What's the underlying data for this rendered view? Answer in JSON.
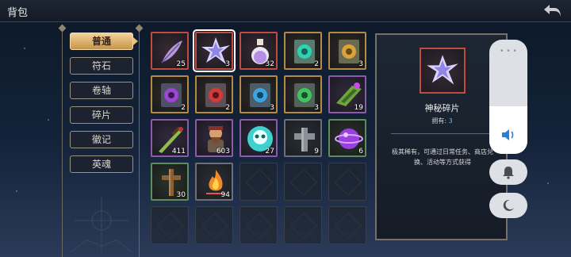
{
  "title": "背包",
  "icons": {
    "back": "back-arrow-icon",
    "volume": "speaker-icon",
    "bell": "bell-icon",
    "moon": "moon-icon"
  },
  "tabs": [
    {
      "label": "普通",
      "active": true
    },
    {
      "label": "符石",
      "active": false
    },
    {
      "label": "卷轴",
      "active": false
    },
    {
      "label": "碎片",
      "active": false
    },
    {
      "label": "徽记",
      "active": false
    },
    {
      "label": "英魂",
      "active": false
    }
  ],
  "inventory": {
    "rows": [
      [
        {
          "icon": "feather-quill-icon",
          "rarity": "red",
          "count": "25"
        },
        {
          "icon": "crystal-shard-icon",
          "rarity": "red",
          "count": "3",
          "selected": true
        },
        {
          "icon": "potion-flask-icon",
          "rarity": "red",
          "count": "32"
        },
        {
          "icon": "teal-rune-scroll-icon",
          "rarity": "gold",
          "count": "2"
        },
        {
          "icon": "gold-rune-scroll-icon",
          "rarity": "gold",
          "count": "3"
        }
      ],
      [
        {
          "icon": "purple-rune-scroll-icon",
          "rarity": "gold",
          "count": "2"
        },
        {
          "icon": "red-rune-scroll-icon",
          "rarity": "gold",
          "count": "2"
        },
        {
          "icon": "blue-rune-scroll-icon",
          "rarity": "gold",
          "count": "3"
        },
        {
          "icon": "green-rune-scroll-icon",
          "rarity": "gold",
          "count": "3"
        },
        {
          "icon": "green-leaf-bundle-icon",
          "rarity": "purple",
          "count": "19"
        }
      ],
      [
        {
          "icon": "green-dagger-icon",
          "rarity": "purple",
          "count": "411"
        },
        {
          "icon": "dwarf-warrior-icon",
          "rarity": "purple",
          "count": "603"
        },
        {
          "icon": "skull-gem-icon",
          "rarity": "purple",
          "count": "27"
        },
        {
          "icon": "stone-cross-icon",
          "rarity": "gray",
          "count": "9"
        },
        {
          "icon": "purple-orb-icon",
          "rarity": "green",
          "count": "6"
        }
      ],
      [
        {
          "icon": "wooden-cross-icon",
          "rarity": "green",
          "count": "30"
        },
        {
          "icon": "fire-ember-icon",
          "rarity": "gray",
          "count": "94"
        },
        {
          "empty": true
        },
        {
          "empty": true
        },
        {
          "empty": true
        }
      ],
      [
        {
          "empty": true
        },
        {
          "empty": true
        },
        {
          "empty": true
        },
        {
          "empty": true
        },
        {
          "empty": true
        }
      ]
    ]
  },
  "detail": {
    "icon": "crystal-shard-icon",
    "name": "神秘碎片",
    "owned_label": "拥有:",
    "owned_value": "3",
    "description": "极其稀有，可通过日常任务、商店兑换、活动等方式获得"
  },
  "system_overlay": {
    "volume_level": 0.42
  },
  "colors": {
    "red": "#c24a3f",
    "gold": "#b58a46",
    "purple": "#8c5aa8",
    "green": "#5e8c5a",
    "gray": "#6c6f75",
    "tab_active": "#e7bf79",
    "owned_value": "#64b6ff"
  }
}
